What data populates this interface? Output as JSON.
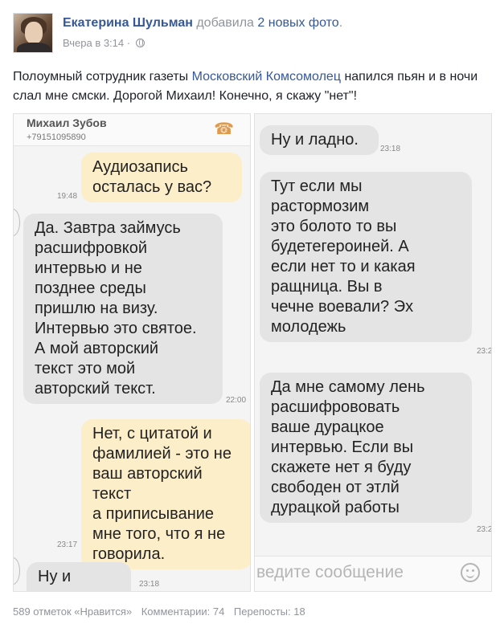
{
  "post": {
    "author": "Екатерина Шульман",
    "action": "добавила",
    "photo_count_link": "2 новых фото",
    "photo_count_suffix": ".",
    "timestamp": "Вчера в 3:14",
    "meta_separator": " · ",
    "privacy_icon": "globe-icon",
    "text_before": "Полоумный сотрудник газеты ",
    "text_link": "Московский Комсомолец",
    "text_after": " напился пьян и в ночи слал мне смски. Дорогой Михаил! Конечно, я скажу \"нет\"!"
  },
  "left_phone": {
    "contact_name": "Михаил Зубов",
    "contact_phone": "+79151095890",
    "call_icon": "phone-icon",
    "messages": [
      {
        "direction": "out",
        "text": "Аудиозапись\nосталась у вас?",
        "time": "19:48"
      },
      {
        "direction": "in",
        "text": "Да. Завтра займусь\nрасшифровкой\nинтервью и не\nпозднее среды\nпришлю на визу.\nИнтервью это святое.\nА мой авторский\nтекст это мой\nавторский текст.",
        "time": "22:00"
      },
      {
        "direction": "out",
        "text": "Нет, с цитатой и\nфамилией - это не\nваш авторский текст\nа приписывание\nмне того, что я не\nговорила.",
        "time": "23:17"
      },
      {
        "direction": "in",
        "text": "Ну и ладно.",
        "time": "23:18"
      }
    ]
  },
  "right_phone": {
    "messages": [
      {
        "direction": "in",
        "text": "Ну и ладно.",
        "time": "23:18"
      },
      {
        "direction": "in",
        "text": "Тут если мы\nрастормозим\nэто болото то вы\nбудетегероиней. А\nесли нет то и какая\nращница. Вы в\nчечне воевали? Эх\nмолодежь",
        "time": "23:2"
      },
      {
        "direction": "in",
        "text": "Да мне самому лень\nрасшифрововать\nваше дурацкое\nинтервью. Если вы\nскажете нет я буду\nсвободен от этлй\nдурацкой работы",
        "time": "23:2"
      }
    ],
    "input_placeholder": "ведите сообщение",
    "emoji_icon": "smiley-icon"
  },
  "footer": {
    "likes": "589 отметок «Нравится»",
    "comments": "Комментарии: 74",
    "shares": "Перепосты: 18"
  },
  "colors": {
    "link": "#365899",
    "meta": "#90949c",
    "outgoing_bubble": "#fdeeca",
    "incoming_bubble": "#e4e4e4"
  }
}
